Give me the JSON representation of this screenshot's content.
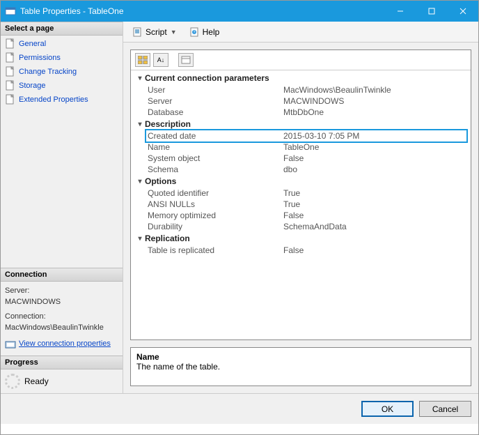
{
  "window": {
    "title": "Table Properties - TableOne"
  },
  "sidebar": {
    "select_page_label": "Select a page",
    "pages": [
      {
        "label": "General"
      },
      {
        "label": "Permissions"
      },
      {
        "label": "Change Tracking"
      },
      {
        "label": "Storage"
      },
      {
        "label": "Extended Properties"
      }
    ],
    "connection_label": "Connection",
    "server_label": "Server:",
    "server_value": "MACWINDOWS",
    "connection_field_label": "Connection:",
    "connection_value": "MacWindows\\BeaulinTwinkle",
    "view_connection_link": "View connection properties",
    "progress_label": "Progress",
    "progress_status": "Ready"
  },
  "toolbar": {
    "script_label": "Script",
    "help_label": "Help"
  },
  "props": {
    "groups": [
      {
        "name": "Current connection parameters",
        "rows": [
          {
            "key": "User",
            "value": "MacWindows\\BeaulinTwinkle"
          },
          {
            "key": "Server",
            "value": "MACWINDOWS"
          },
          {
            "key": "Database",
            "value": "MtbDbOne"
          }
        ]
      },
      {
        "name": "Description",
        "rows": [
          {
            "key": "Created date",
            "value": "2015-03-10 7:05 PM",
            "highlight": true
          },
          {
            "key": "Name",
            "value": "TableOne"
          },
          {
            "key": "System object",
            "value": "False"
          },
          {
            "key": "Schema",
            "value": "dbo"
          }
        ]
      },
      {
        "name": "Options",
        "rows": [
          {
            "key": "Quoted identifier",
            "value": "True"
          },
          {
            "key": "ANSI NULLs",
            "value": "True"
          },
          {
            "key": "Memory optimized",
            "value": "False"
          },
          {
            "key": "Durability",
            "value": "SchemaAndData"
          }
        ]
      },
      {
        "name": "Replication",
        "rows": [
          {
            "key": "Table is replicated",
            "value": "False"
          }
        ]
      }
    ]
  },
  "description": {
    "name": "Name",
    "text": "The name of the table."
  },
  "footer": {
    "ok": "OK",
    "cancel": "Cancel"
  }
}
